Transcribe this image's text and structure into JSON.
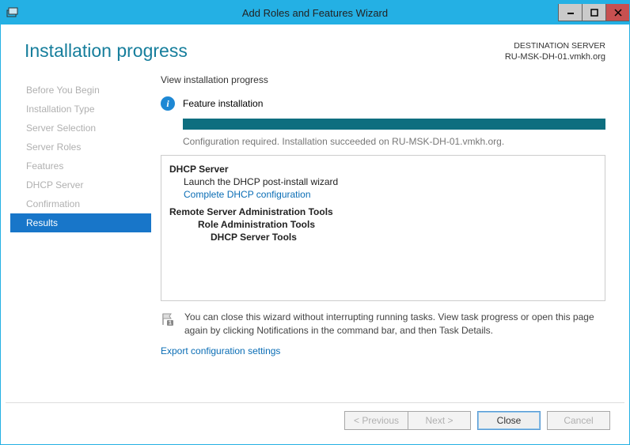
{
  "titlebar": {
    "title": "Add Roles and Features Wizard"
  },
  "header": {
    "page_title": "Installation progress",
    "dest_label": "DESTINATION SERVER",
    "dest_value": "RU-MSK-DH-01.vmkh.org"
  },
  "sidebar": {
    "items": [
      {
        "label": "Before You Begin",
        "active": false
      },
      {
        "label": "Installation Type",
        "active": false
      },
      {
        "label": "Server Selection",
        "active": false
      },
      {
        "label": "Server Roles",
        "active": false
      },
      {
        "label": "Features",
        "active": false
      },
      {
        "label": "DHCP Server",
        "active": false
      },
      {
        "label": "Confirmation",
        "active": false
      },
      {
        "label": "Results",
        "active": true
      }
    ]
  },
  "main": {
    "subheading": "View installation progress",
    "feature_label": "Feature installation",
    "progress": 100,
    "status_text": "Configuration required. Installation succeeded on RU-MSK-DH-01.vmkh.org.",
    "details": {
      "dhcp_server": "DHCP Server",
      "launch_text": "Launch the DHCP post-install wizard",
      "complete_link": "Complete DHCP configuration",
      "rsat": "Remote Server Administration Tools",
      "role_admin": "Role Administration Tools",
      "dhcp_tools": "DHCP Server Tools"
    },
    "footnote": "You can close this wizard without interrupting running tasks. View task progress or open this page again by clicking Notifications in the command bar, and then Task Details.",
    "export_link": "Export configuration settings"
  },
  "footer": {
    "previous": "< Previous",
    "next": "Next >",
    "close": "Close",
    "cancel": "Cancel"
  }
}
